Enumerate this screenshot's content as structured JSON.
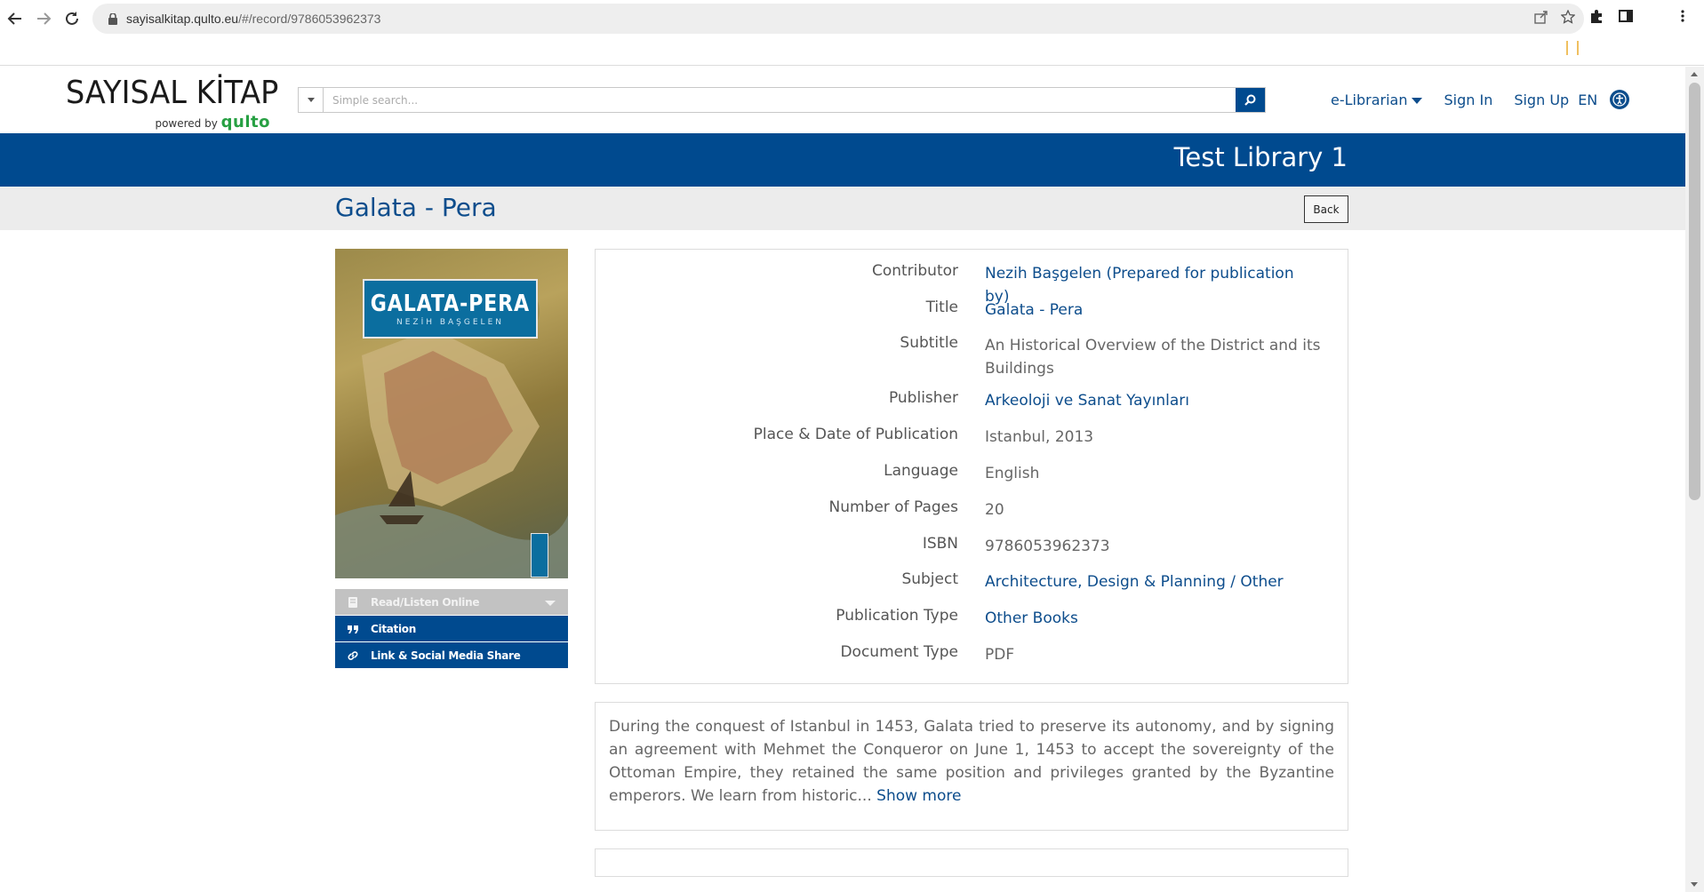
{
  "browser": {
    "url_host": "sayisalkitap.qulto.eu",
    "url_path": "/#/record/9786053962373"
  },
  "header": {
    "logo_name": "SAYISAL KİTAP",
    "logo_powered": "powered by",
    "logo_brand": "qulto",
    "search_placeholder": "Simple search...",
    "nav": {
      "librarian": "e-Librarian",
      "sign_in": "Sign In",
      "sign_up": "Sign Up",
      "language": "EN"
    }
  },
  "library_name": "Test Library 1",
  "record": {
    "title": "Galata - Pera",
    "back_label": "Back",
    "cover": {
      "title": "GALATA-PERA",
      "author": "NEZİH BAŞGELEN"
    },
    "actions": [
      {
        "label": "Read/Listen Online",
        "icon": "book-icon",
        "enabled": false
      },
      {
        "label": "Citation",
        "icon": "quote-icon",
        "enabled": true
      },
      {
        "label": "Link & Social Media Share",
        "icon": "link-icon",
        "enabled": true
      }
    ],
    "metadata": [
      {
        "label": "Contributor",
        "value": "Nezih Başgelen (Prepared for publication by)",
        "link": true
      },
      {
        "label": "Title",
        "value": "Galata - Pera",
        "link": true
      },
      {
        "label": "Subtitle",
        "value": "An Historical Overview of the District and its Buildings",
        "link": false
      },
      {
        "label": "Publisher",
        "value": "Arkeoloji ve Sanat Yayınları",
        "link": true
      },
      {
        "label": "Place & Date of Publication",
        "value": "Istanbul, 2013",
        "link": false
      },
      {
        "label": "Language",
        "value": "English",
        "link": false
      },
      {
        "label": "Number of Pages",
        "value": "20",
        "link": false
      },
      {
        "label": "ISBN",
        "value": "9786053962373",
        "link": false
      },
      {
        "label": "Subject",
        "value": "Architecture, Design & Planning / Other",
        "link": true
      },
      {
        "label": "Publication Type",
        "value": "Other Books",
        "link": true
      },
      {
        "label": "Document Type",
        "value": "PDF",
        "link": false
      }
    ],
    "description": "During the conquest of Istanbul in 1453, Galata tried to preserve its autonomy, and by signing an agreement with Mehmet the Conqueror on June 1, 1453 to accept the sovereignty of the Ottoman Empire, they retained the same position and privileges granted by the Byzantine emperors. We learn from historic...",
    "show_more": "Show more"
  },
  "colors": {
    "brand_blue": "#004a8f",
    "link_blue": "#0d4d8c",
    "qulto_green": "#27a043"
  }
}
